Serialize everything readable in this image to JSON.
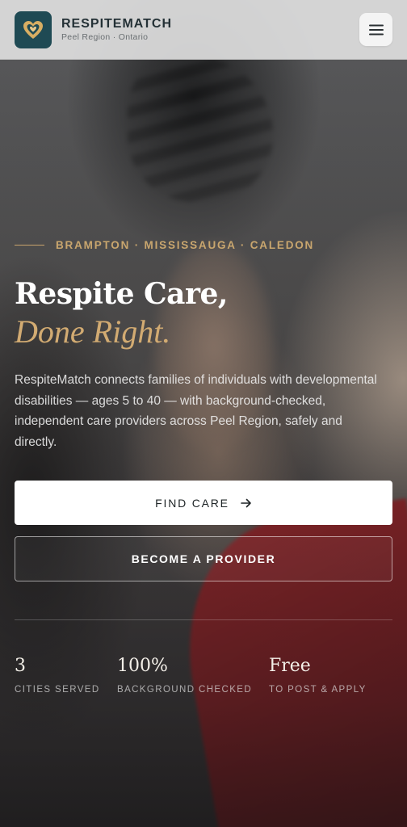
{
  "header": {
    "brand_name": "RESPITEMATCH",
    "brand_sub": "Peel Region · Ontario",
    "logo_icon": "heart-icon",
    "menu_icon": "hamburger-menu-icon"
  },
  "hero": {
    "eyebrow": "BRAMPTON · MISSISSAUGA · CALEDON",
    "headline": "Respite Care,",
    "headline_accent": "Done Right.",
    "lede": "RespiteMatch connects families of individuals with developmental disabilities — ages 5 to 40 — with background-checked, independent care providers across Peel Region, safely and directly.",
    "primary_cta": "FIND CARE",
    "primary_cta_icon": "arrow-right-icon",
    "secondary_cta": "BECOME A PROVIDER"
  },
  "stats": [
    {
      "value": "3",
      "label": "CITIES SERVED"
    },
    {
      "value": "100%",
      "label": "BACKGROUND CHECKED"
    },
    {
      "value": "Free",
      "label": "TO POST & APPLY"
    }
  ],
  "colors": {
    "accent_gold": "#c9a66e",
    "logo_bg": "#1f4a54"
  }
}
